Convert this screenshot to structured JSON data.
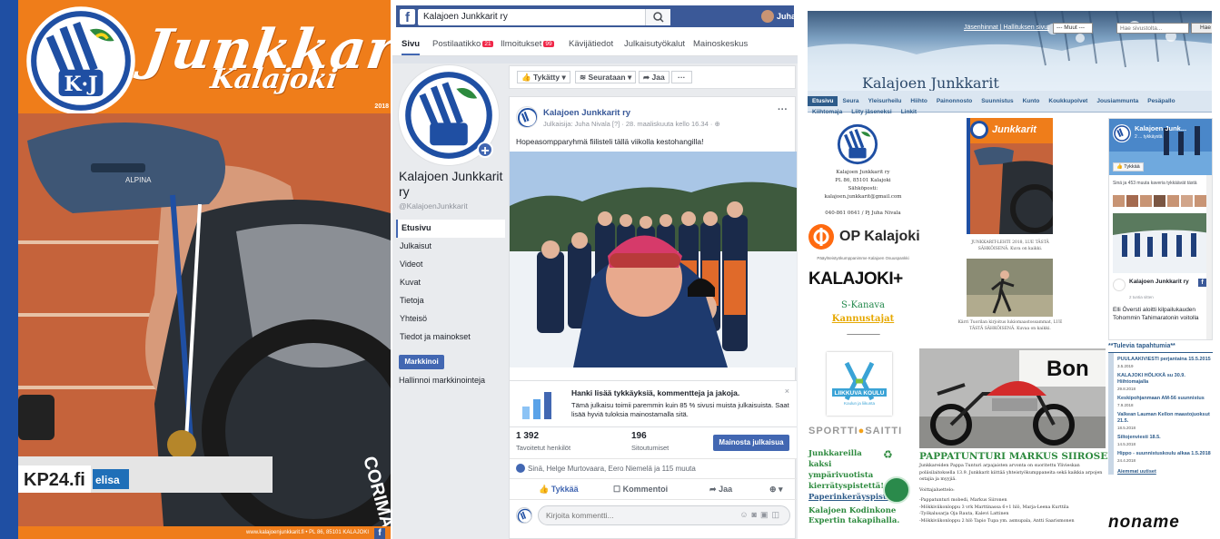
{
  "cover": {
    "brand": "Junkkarit",
    "sub": "Kalajoki",
    "year": "2018",
    "footer": "www.kalajoenjunkkarit.fi • PL 86, 85101 KALAJOKI",
    "logo_letters": "K·J",
    "sponsor_left": "KP24.fi",
    "sponsor_right": "elisa",
    "helmet_text": "ALPINA",
    "wheel_text": "CORIMA"
  },
  "facebook": {
    "search_value": "Kalajoen Junkkarit ry",
    "user_name": "Juha",
    "tabs": [
      {
        "label": "Sivu"
      },
      {
        "label": "Postilaatikko",
        "badge": "21"
      },
      {
        "label": "Ilmoitukset",
        "badge": "99"
      },
      {
        "label": "Kävijätiedot"
      },
      {
        "label": "Julkaisutyökalut"
      },
      {
        "label": "Mainoskeskus"
      }
    ],
    "page_name": "Kalajoen Junkkarit ry",
    "handle": "@KalajoenJunkkarit",
    "side": [
      "Etusivu",
      "Julkaisut",
      "Videot",
      "Kuvat",
      "Tietoja",
      "Yhteisö",
      "Tiedot ja mainokset"
    ],
    "promote": "Markkinoi",
    "manage": "Hallinnoi markkinointeja",
    "actions": [
      "Tykätty",
      "Seurataan",
      "Jaa",
      "···"
    ],
    "post": {
      "author": "Kalajoen Junkkarit ry",
      "meta": "Julkaisija: Juha Nivala [?] · 28. maaliskuuta kello 16.34 · ",
      "text": "Hopeasompparyhmä fiilisteli tällä viikolla kestohangilla!",
      "boost_title": "Hanki lisää tykkäyksiä, kommentteja ja jakoja.",
      "boost_text": "Tämä julkaisu toimii paremmin kuin 85 % sivusi muista julkaisuista. Saat lisää hyviä tuloksia mainostamalla sitä.",
      "reach": "1 392",
      "reach_label": "Tavoitetut henkilöt",
      "engagement": "196",
      "engagement_label": "Sitoutumiset",
      "boost_btn": "Mainosta julkaisua",
      "likes": "Sinä, Helge Murtovaara, Eero Niemelä ja 115 muuta",
      "like_btn": "Tykkää",
      "comment_btn": "Kommentoi",
      "share_btn": "Jaa",
      "comment_placeholder": "Kirjoita kommentti..."
    }
  },
  "website": {
    "top_links": "Jäsenhinnat | Hallituksen sivut",
    "select": "--- Muut --- ",
    "search_placeholder": "Hae sivustolta...",
    "search_btn": "Hae",
    "title": "Kalajoen Junkkarit",
    "menu_row1": [
      "Etusivu",
      "Seura",
      "Yleisurheilu",
      "Hiihto",
      "Painonnosto",
      "Suunnistus",
      "Kunto",
      "Koukkupolvet",
      "Jousiammunta",
      "Pesäpallo"
    ],
    "menu_row2": [
      "Kiihtomaja",
      "Liity jäseneksi",
      "Linkit"
    ],
    "address": [
      "Kalajoen Junkkarit ry",
      "PL 86, 85101 Kalajoki",
      "Sähköposti:",
      "kalajoen.junkkarit@gmail.com",
      "",
      "040-861 0641 / Pj Juha Nivala"
    ],
    "op": "OP Kalajoki",
    "main_partner": "Pääyhteistyökumppanimme Kalajoen Osuuspankki",
    "kalajoki": "KALAJOKI",
    "skanava": "S-Kanava",
    "kannustajat": "Kannustajat",
    "dashes": "------------------------------------",
    "liikkuva": "LIIKKUVA KOULU",
    "liikkuva_sub": "Koulun ja liikunta",
    "sportti": "SPORTTI",
    "saitti": "SAITTI",
    "junk_text": "Junkkareilla kaksi ympärivuotista kierrätyspistettä!",
    "paperi": "Paperinkeräyspiste",
    "kodinkone": "Kalajoen Kodinkone Expertin takapihalla.",
    "cover_caption": "JUNKKARIT-LEHTI 2018, LUE TÄSTÄ SÄHKÖISENÄ. Kuva on kaikki.",
    "runner_caption": "Kärri Tuorilan kirjoitus lukiomaastossammat, LUE TÄSTÄ SÄHKÖISENÄ. Kuvaa on kaikki.",
    "bon": "Bon",
    "news_title": "PAPPATUNTURI MARKUS SIIROSELLE",
    "news_text": "Junkkareiden Pappa Tunturi arpajaisten arvonta on suoritettu Ylivieskan poliisilaitoksella 13.9. Junkkarit kiittää yhteistyökumppaneita sekä kaikkia arpojen ostajia ja myyjiä.",
    "winners_h": "Voittajaluettelo:",
    "winners": [
      "-Pappatunturi mobedi, Markus Siironen",
      "-Mökkiviikonloppu 3 vrk Marttinassa 6+1 hlö, Marja-Leena Kurttila",
      "-Työkalusarja Oja Rauta, Kalevi Lattinen",
      "-Mökkiviikonloppu 2 hlö Tapio Tupa ym. asmupala, Antti Saarismonen"
    ],
    "fb_widget_name": "Kalajoen Junk...",
    "fb_widget_likes": "2 ... tykkäystä",
    "fb_widget_like": "Tykkää",
    "fb_widget_friends": "Sinä ja 453 muuta kaveria tykkäävät tästä",
    "fb_widget_post_author": "Kalajoen Junkkarit ry",
    "fb_widget_post_time": "2 tuntia sitten",
    "fb_widget_post_text": "Elli Överstі aloitti kilpailukauden Tohommin Tahimaratonin voitolla",
    "events_h": "**Tulevia tapahtumia**",
    "events": [
      {
        "t": "PUULAAKIVIESTI perjantaina 15.5.2015",
        "d": "3.5.2019"
      },
      {
        "t": "KALAJOKI HÖLKKÄ su 30.9. Hiihtomajalla",
        "d": "29.8.2018"
      },
      {
        "t": "Keskipohjanmaan AM-56 suunnistus",
        "d": "7.9.2018"
      },
      {
        "t": "Valkean Lauman Kellon maastojuoksut 21.5.",
        "d": "18.5.2018"
      },
      {
        "t": "Siltojenviesti 18.5.",
        "d": "14.5.2018"
      },
      {
        "t": "Hippo - suunnistuskoulu alkaa 1.5.2018",
        "d": "24.4.2018"
      }
    ],
    "all_news": "Aiemmat uutiset",
    "noname": "noname"
  },
  "colors": {
    "orange": "#ef7d1a",
    "fb_blue": "#3b5998",
    "junk_blue": "#1f4fa3",
    "green": "#2d8a3e"
  }
}
